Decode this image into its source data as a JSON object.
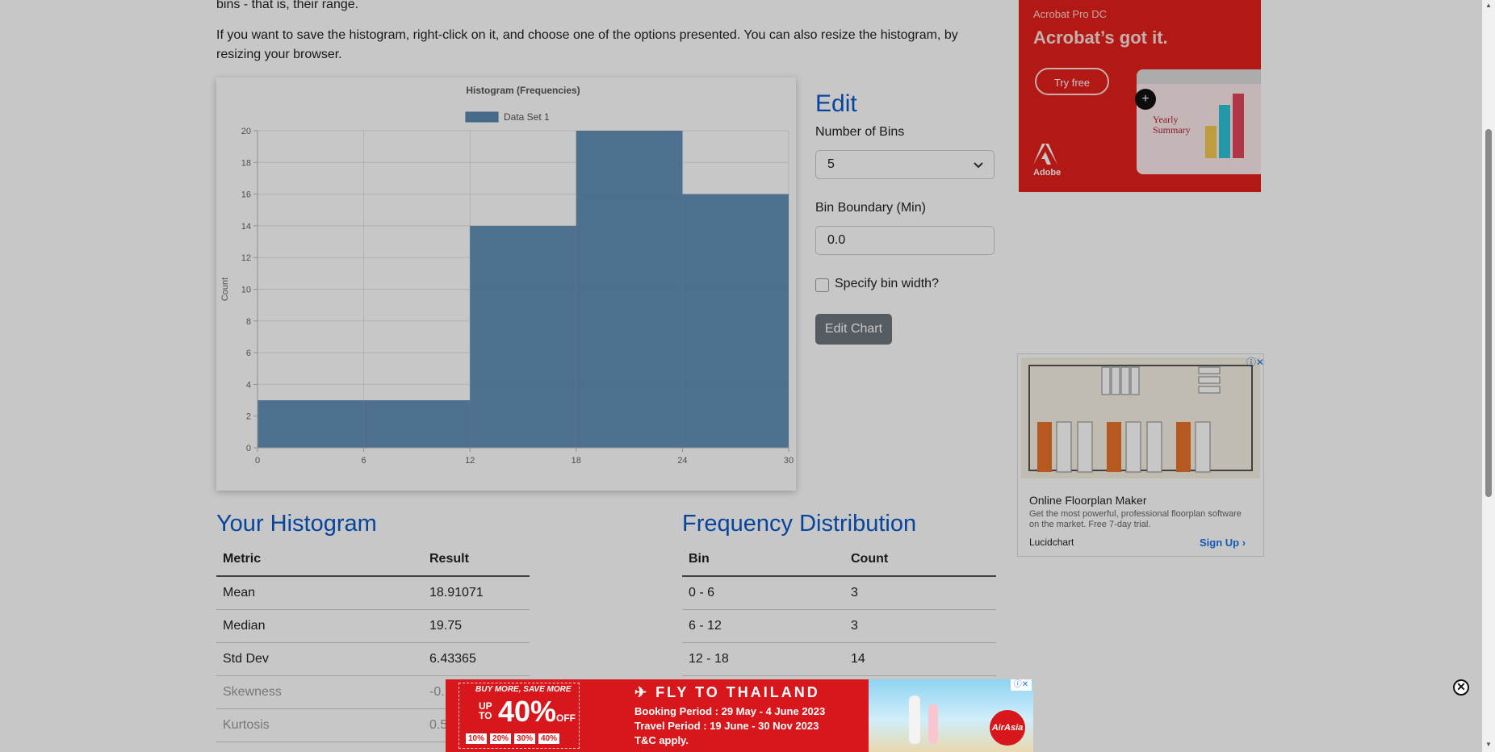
{
  "intro": {
    "line1": "bins - that is, their range.",
    "line2": "If you want to save the histogram, right-click on it, and choose one of the options presented. You can also resize the histogram, by",
    "line3": "resizing your browser."
  },
  "chart_data": {
    "type": "bar",
    "title": "Histogram (Frequencies)",
    "legend": "Data Set 1",
    "ylabel": "Count",
    "xlabel": "",
    "x_edges": [
      0,
      6,
      12,
      18,
      24,
      30
    ],
    "values": [
      3,
      3,
      14,
      20,
      16
    ],
    "ylim": [
      0,
      20
    ],
    "y_ticks": [
      0,
      2,
      4,
      6,
      8,
      10,
      12,
      14,
      16,
      18,
      20
    ],
    "x_ticks": [
      0,
      6,
      12,
      18,
      24,
      30
    ],
    "bar_color": "#5b8ab3",
    "legend_position": "top-center",
    "grid": true
  },
  "edit": {
    "title": "Edit",
    "bins_label": "Number of Bins",
    "bins_value": "5",
    "boundary_label": "Bin Boundary (Min)",
    "boundary_value": "0.0",
    "specify_width_label": "Specify bin width?",
    "button_label": "Edit Chart"
  },
  "your_histogram": {
    "title": "Your Histogram",
    "headers": [
      "Metric",
      "Result"
    ],
    "rows": [
      [
        "Mean",
        "18.91071"
      ],
      [
        "Median",
        "19.75"
      ],
      [
        "Std Dev",
        "6.43365"
      ],
      [
        "Skewness",
        "-0."
      ],
      [
        "Kurtosis",
        "0.5"
      ]
    ]
  },
  "frequency": {
    "title": "Frequency Distribution",
    "headers": [
      "Bin",
      "Count"
    ],
    "rows": [
      [
        "0 - 6",
        "3"
      ],
      [
        "6 - 12",
        "3"
      ],
      [
        "12 - 18",
        "14"
      ]
    ]
  },
  "ad_top": {
    "product": "Acrobat Pro DC",
    "headline": "Acrobat’s got it.",
    "cta": "Try free",
    "brand": "Adobe",
    "doc_title_1": "Yearly",
    "doc_title_2": "Summary"
  },
  "ad_side": {
    "title": "Online Floorplan Maker",
    "desc_1": "Get the most powerful, professional floorplan software",
    "desc_2": "on the market. Free 7-day trial.",
    "brand": "Lucidchart",
    "cta": "Sign Up"
  },
  "ad_bottom": {
    "promo": "BUY MORE, SAVE MORE",
    "up_to": "UP TO",
    "percent": "40%",
    "off": "OFF",
    "tiers": [
      "10%",
      "20%",
      "30%",
      "40%"
    ],
    "headline": "✈ FLY TO THAILAND",
    "booking": "Booking Period : 29 May - 4 June 2023",
    "travel": "Travel Period : 19 June - 30 Nov 2023",
    "tc": "T&C apply.",
    "brand": "AirAsia"
  },
  "colors": {
    "heading_blue": "#0a58ca",
    "button_gray": "#6c757d",
    "ad_red": "#e5211c"
  }
}
